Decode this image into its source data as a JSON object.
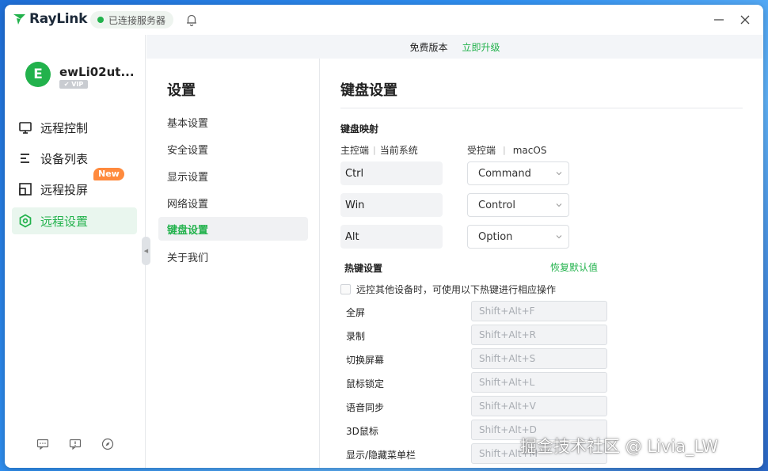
{
  "app": {
    "name": "RayLink",
    "connection_status": "已连接服务器",
    "accent_color": "#22b24c"
  },
  "banner": {
    "version_text": "免费版本",
    "upgrade_link": "立即升级"
  },
  "user": {
    "avatar_letter": "E",
    "name": "ewLi02ut...",
    "vip_label": "✔ VIP"
  },
  "sidebar": {
    "items": [
      {
        "label": "远程控制",
        "icon": "monitor-icon"
      },
      {
        "label": "设备列表",
        "icon": "list-icon"
      },
      {
        "label": "远程投屏",
        "icon": "screen-cast-icon"
      },
      {
        "label": "远程设置",
        "icon": "settings-hex-icon"
      }
    ],
    "new_badge": "New",
    "bottom_icons": [
      "chat-icon",
      "feedback-icon",
      "compass-icon"
    ]
  },
  "settings_menu": {
    "title": "设置",
    "items": [
      "基本设置",
      "安全设置",
      "显示设置",
      "网络设置",
      "键盘设置",
      "关于我们"
    ]
  },
  "keyboard": {
    "title": "键盘设置",
    "mapping_title": "键盘映射",
    "local_label": "主控端",
    "local_system": "当前系统",
    "remote_label": "受控端",
    "remote_system": "macOS",
    "mappings": [
      {
        "local": "Ctrl",
        "remote": "Command"
      },
      {
        "local": "Win",
        "remote": "Control"
      },
      {
        "local": "Alt",
        "remote": "Option"
      }
    ],
    "hotkey_title": "热键设置",
    "restore_default": "恢复默认值",
    "hotkey_checkbox_label": "远控其他设备时，可使用以下热键进行相应操作",
    "hotkey_checkbox_checked": false,
    "hotkeys": [
      {
        "label": "全屏",
        "shortcut": "Shift+Alt+F"
      },
      {
        "label": "录制",
        "shortcut": "Shift+Alt+R"
      },
      {
        "label": "切换屏幕",
        "shortcut": "Shift+Alt+S"
      },
      {
        "label": "鼠标锁定",
        "shortcut": "Shift+Alt+L"
      },
      {
        "label": "语音同步",
        "shortcut": "Shift+Alt+V"
      },
      {
        "label": "3D鼠标",
        "shortcut": "Shift+Alt+D"
      },
      {
        "label": "显示/隐藏菜单栏",
        "shortcut": "Shift+Alt+M"
      }
    ]
  },
  "watermark": "掘金技术社区 @ Livia_LW"
}
